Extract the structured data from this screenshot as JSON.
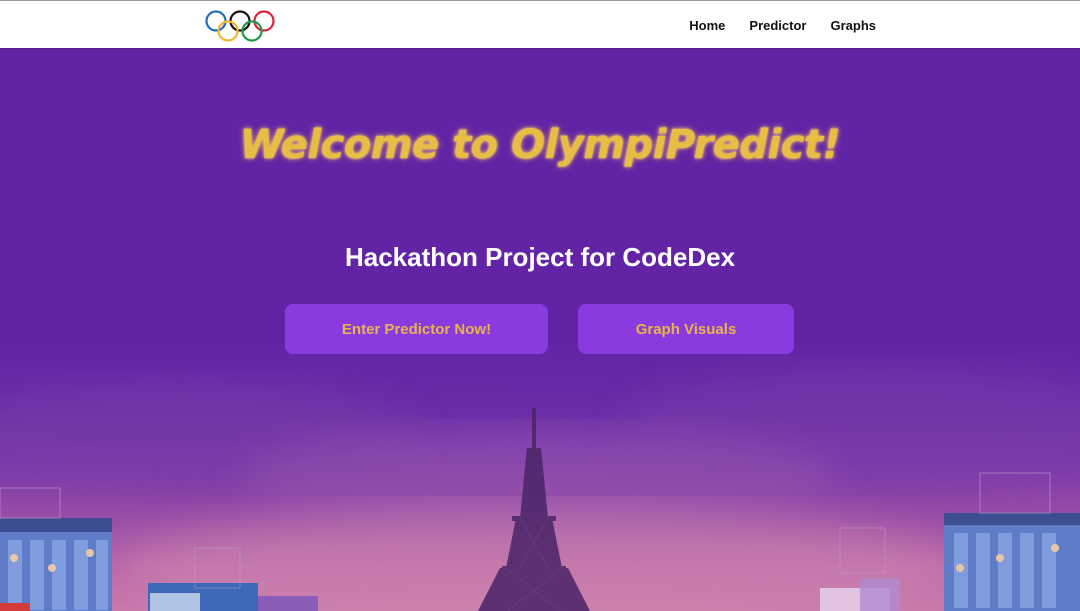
{
  "header": {
    "logo_icon": "olympic-rings-icon",
    "nav": [
      {
        "label": "Home"
      },
      {
        "label": "Predictor"
      },
      {
        "label": "Graphs"
      }
    ]
  },
  "hero": {
    "title": "Welcome to OlympiPredict!",
    "subtitle": "Hackathon Project for CodeDex",
    "buttons": {
      "predictor_label": "Enter Predictor Now!",
      "graphs_label": "Graph Visuals"
    },
    "background_image": "paris-eiffel-tower-olympic-scene"
  },
  "colors": {
    "background": "#6223a3",
    "button": "#8a3be0",
    "title_gold": "#e7bd44",
    "button_text": "#e8b548",
    "header": "#ffffff"
  }
}
